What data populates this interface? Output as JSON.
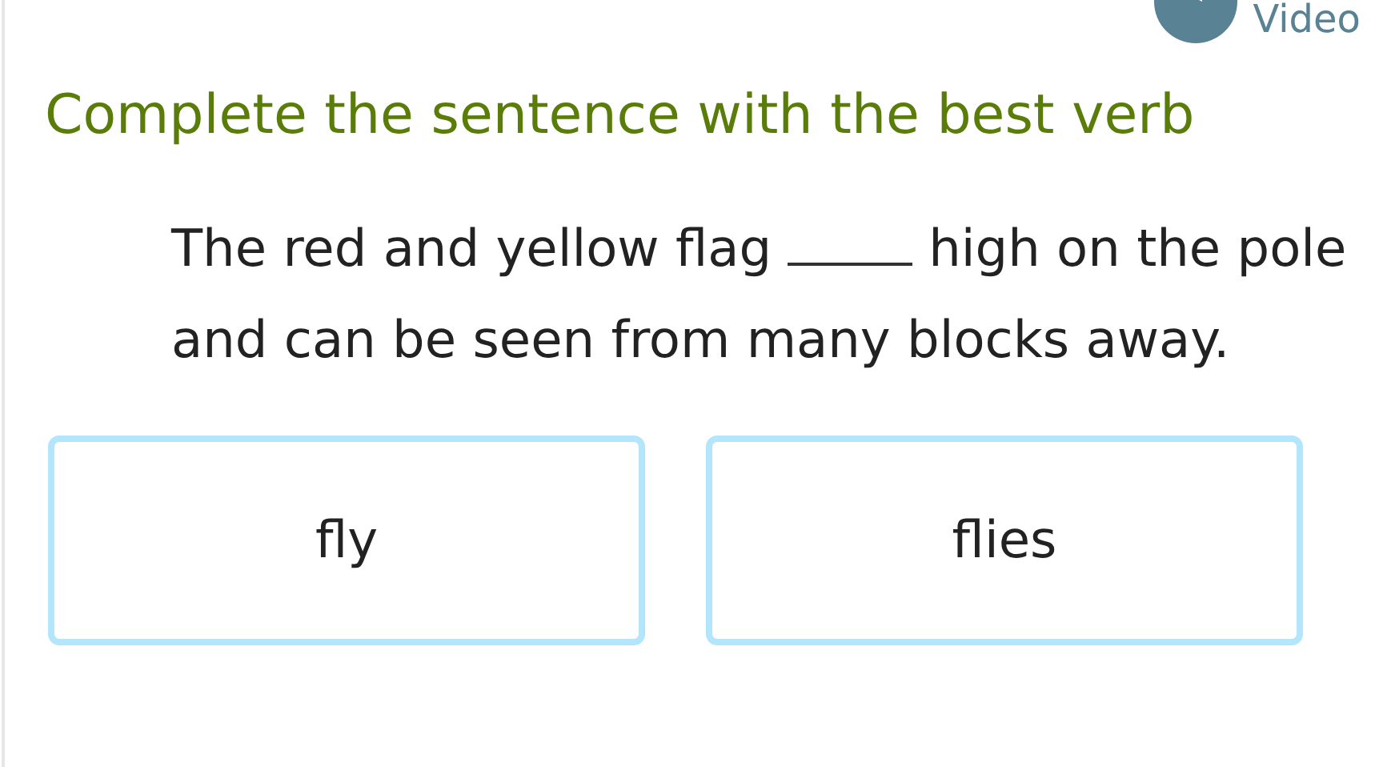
{
  "video_link": {
    "label": "Video"
  },
  "title": "Complete the sentence with the best verb",
  "question": {
    "before": "The red and yellow flag",
    "after": "high on the pole and can be seen from many blocks away."
  },
  "choices": [
    {
      "label": "fly"
    },
    {
      "label": "flies"
    }
  ]
}
